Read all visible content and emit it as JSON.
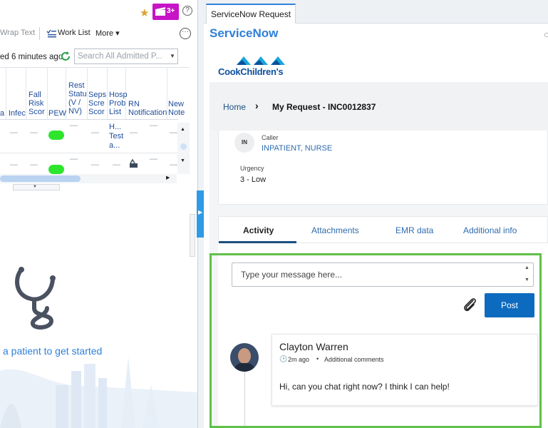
{
  "left": {
    "toolbar": {
      "wrap_text": "Wrap Text",
      "work_list": "Work List",
      "more": "More ▾"
    },
    "notification_badge": "3+",
    "refresh_text": "ed 6 minutes ago",
    "search_placeholder": "Search All Admitted P...",
    "columns": [
      {
        "id": "col_a",
        "label": "a"
      },
      {
        "id": "col_infec",
        "label": "Infec"
      },
      {
        "id": "col_fall",
        "label": "Fall Risk Scor"
      },
      {
        "id": "col_pew",
        "label": "PEW"
      },
      {
        "id": "col_rest",
        "label": "Rest Statu (V / NV)"
      },
      {
        "id": "col_seps",
        "label": "Seps Scre Scor"
      },
      {
        "id": "col_hosp",
        "label": "Hosp Prob List"
      },
      {
        "id": "col_rn",
        "label": "RN Notification"
      },
      {
        "id": "col_new",
        "label": "New Note"
      }
    ],
    "row1_hosp": "H... Test a...",
    "empty_state": "a patient to get started",
    "colors": {
      "pew_green": "#2ee52e",
      "link": "#1f4e9b",
      "badge": "#c614c6"
    }
  },
  "right": {
    "tab_label": "ServiceNow Request",
    "title": "ServiceNow",
    "logo_text": "CookChildren's",
    "breadcrumb": {
      "home": "Home",
      "current": "My Request - INC0012837"
    },
    "caller": {
      "initials": "IN",
      "label": "Caller",
      "value": "INPATIENT, NURSE"
    },
    "urgency": {
      "label": "Urgency",
      "value": "3 - Low"
    },
    "tabs": [
      {
        "label": "Activity",
        "active": true
      },
      {
        "label": "Attachments",
        "active": false
      },
      {
        "label": "EMR data",
        "active": false
      },
      {
        "label": "Additional info",
        "active": false
      }
    ],
    "message_placeholder": "Type your message here...",
    "post_label": "Post",
    "comment": {
      "author": "Clayton Warren",
      "time": "2m ago",
      "type": "Additional comments",
      "text": "Hi, can you chat right now? I think I can help!"
    },
    "colors": {
      "brand_blue": "#2e7fd8",
      "post_button": "#0d6bbf",
      "highlight_green": "#5fc04a"
    }
  }
}
